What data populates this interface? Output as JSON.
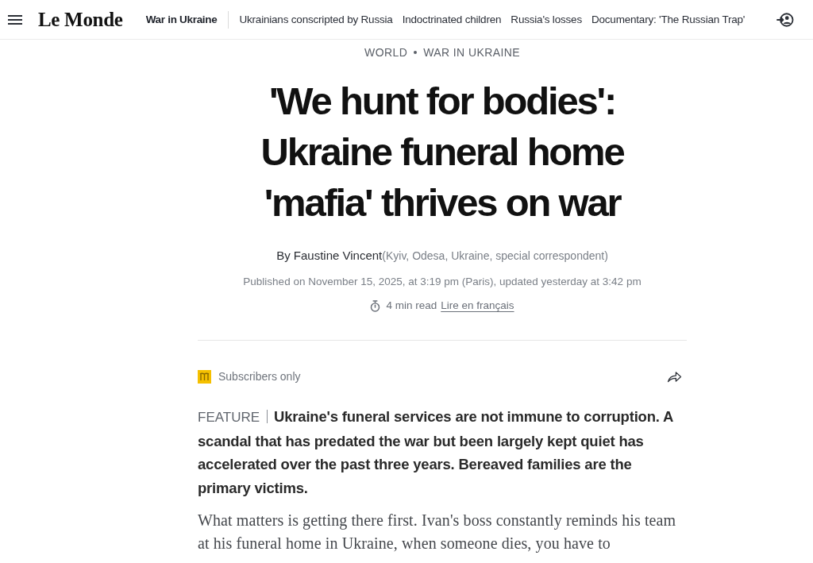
{
  "header": {
    "logo": "Le Monde",
    "section": "War in Ukraine",
    "links": [
      "Ukrainians conscripted by Russia",
      "Indoctrinated children",
      "Russia's losses",
      "Documentary: 'The Russian Trap'"
    ]
  },
  "breadcrumbs": [
    "WORLD",
    "WAR IN UKRAINE"
  ],
  "headline": "'We hunt for bodies': Ukraine funeral home 'mafia' thrives on war",
  "byline": {
    "author": "By Faustine Vincent",
    "location": "(Kyiv, Odesa, Ukraine, special correspondent)"
  },
  "published": "Published on November 15, 2025, at 3:19 pm (Paris), updated yesterday at 3:42 pm",
  "reading": {
    "time": "4 min read",
    "translation_link": "Lire en français"
  },
  "access": {
    "label": "Subscribers only"
  },
  "lead": {
    "label": "FEATURE",
    "text": "Ukraine's funeral services are not immune to corruption. A scandal that has predated the war but been largely kept quiet has accelerated over the past three years. Bereaved families are the primary victims."
  },
  "body": [
    "What matters is getting there first. Ivan's boss constantly reminds his team at his funeral home in Ukraine, when someone dies, you have to"
  ]
}
